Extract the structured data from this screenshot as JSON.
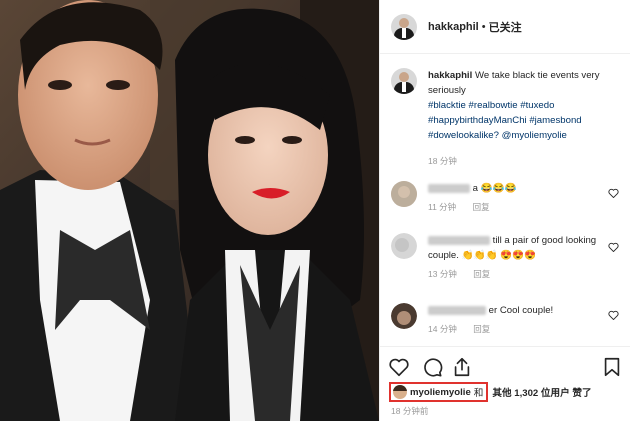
{
  "header": {
    "username": "hakkaphil",
    "separator": "•",
    "follow_status": "已关注"
  },
  "caption": {
    "username": "hakkaphil",
    "text": "We take black tie events very seriously",
    "hashtags": [
      "#blacktie",
      "#realbowtie",
      "#tuxedo",
      "#happybirthdayManChi",
      "#jamesbond",
      "#dowelookalike?"
    ],
    "mention": "@myoliemyolie",
    "time": "18 分钟"
  },
  "comments": [
    {
      "text": "a 😂😂😂",
      "time": "11 分钟",
      "reply": "回复"
    },
    {
      "text": "till a pair of good looking couple. 👏👏👏 😍😍😍",
      "time": "13 分钟",
      "reply": "回复"
    },
    {
      "text": "er Cool couple!",
      "time": "14 分钟",
      "reply": "回复"
    }
  ],
  "likes": {
    "first_user": "myoliemyolie",
    "and": "和",
    "others_text": "其他 1,302 位用户 赞了"
  },
  "post_time": "18 分钟前",
  "icons": {
    "like": "heart-icon",
    "comment": "speech-bubble-icon",
    "share": "paper-plane-icon",
    "save": "bookmark-icon"
  },
  "colors": {
    "hashtag": "#003569",
    "highlight_box": "#e0322e",
    "meta_text": "#999999"
  }
}
